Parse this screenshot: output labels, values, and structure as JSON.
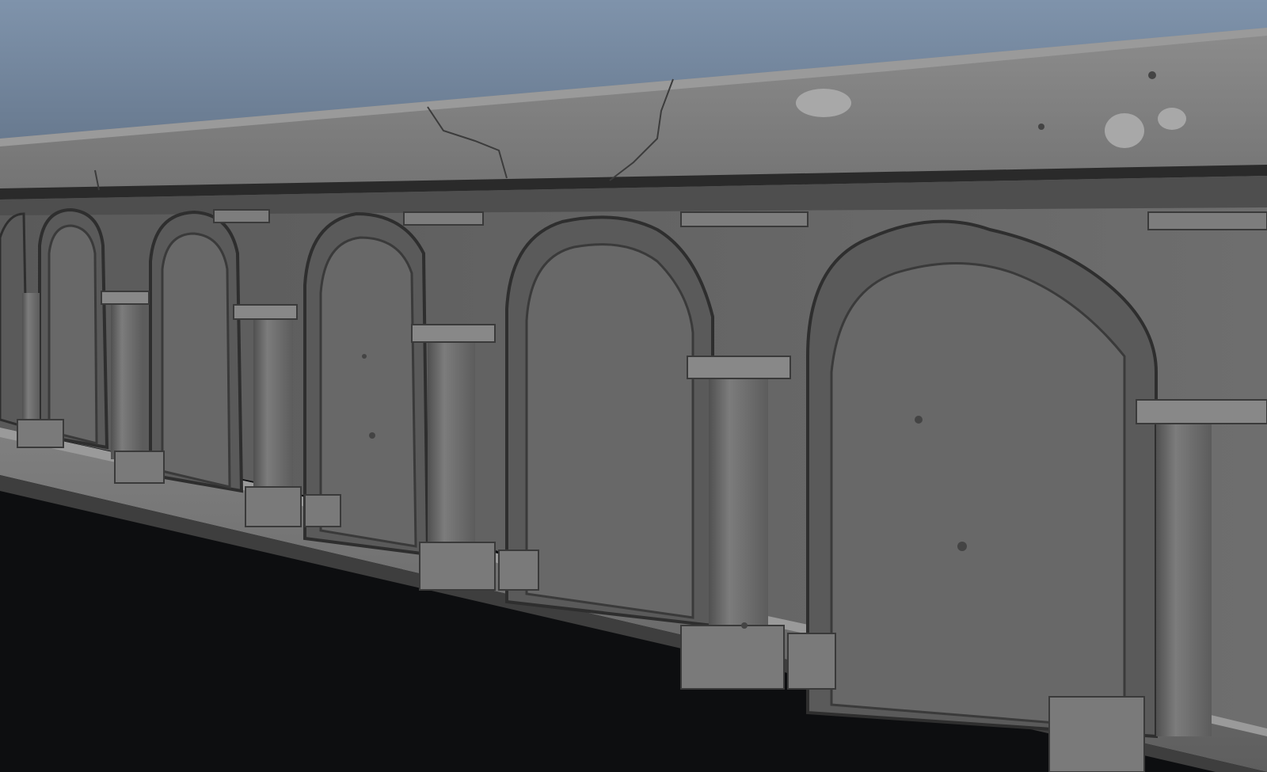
{
  "scene": {
    "subject": "sculpted-stone-arcade-wall",
    "background_top": "#7f93ab",
    "background_bottom": "#0a0b0d",
    "stone_base": "#6f6f6f",
    "stone_light": "#8a8a8a",
    "stone_dark": "#3a3a3a",
    "arch_count": 6
  }
}
